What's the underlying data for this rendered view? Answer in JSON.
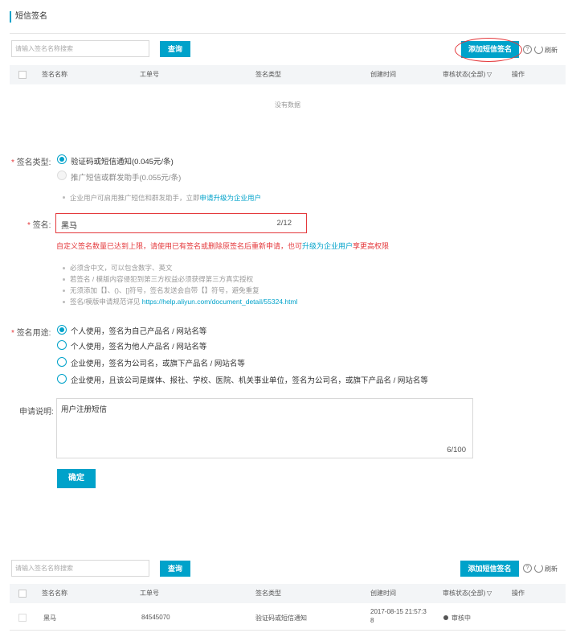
{
  "page_title": "短信签名",
  "toolbar": {
    "search_placeholder": "请输入签名名称搜索",
    "query_label": "查询",
    "add_label": "添加短信签名",
    "help_glyph": "?",
    "refresh_label": "刷新"
  },
  "table": {
    "columns": [
      "签名名称",
      "工单号",
      "签名类型",
      "创建时间",
      "审核状态(全部)",
      "操作"
    ],
    "empty_text": "没有数据",
    "rows": [
      {
        "name": "黑马",
        "ticket": "84545070",
        "type": "验证码或短信通知",
        "created_line1": "2017-08-15 21:57:3",
        "created_line2": "8",
        "status": "审核中"
      }
    ]
  },
  "form": {
    "required_mark": "*",
    "type_label": "签名类型:",
    "type_options": [
      "验证码或短信通知(0.045元/条)",
      "推广短信或群发助手(0.055元/条)"
    ],
    "type_tip_prefix": "企业用户可启用推广短信和群发助手，立即",
    "type_tip_link": "申请升级为企业用户",
    "sig_label": "签名:",
    "sig_value": "黑马",
    "sig_count": "2/12",
    "error_prefix": "自定义签名数量已达到上限，请使用已有签名或删除原签名后重新申请，也可",
    "error_link": "升级为企业用户",
    "error_suffix": "享更高权限",
    "rules": [
      "必须含中文，可以包含数字、英文",
      "若签名 / 模版内容侵犯到第三方权益必须获得第三方真实授权",
      "无须添加【】、()、[]符号，签名发送会自带【】符号，避免重复"
    ],
    "rule_link_prefix": "签名/模版申请规范详见 ",
    "rule_link": "https://help.aliyun.com/document_detail/55324.html",
    "use_label": "签名用途:",
    "use_options": [
      "个人使用，签名为自己产品名 / 网站名等",
      "个人使用，签名为他人产品名 / 网站名等",
      "企业使用，签名为公司名，或旗下产品名 / 网站名等",
      "企业使用，且该公司是媒体、报社、学校、医院、机关事业单位，签名为公司名，或旗下产品名 / 网站名等"
    ],
    "desc_label": "申请说明:",
    "desc_value": "用户注册短信",
    "desc_count": "6/100",
    "submit_label": "确定"
  },
  "colors": {
    "accent": "#00a2ca",
    "error": "#e4393c",
    "header_bg": "#f3f5f7"
  }
}
